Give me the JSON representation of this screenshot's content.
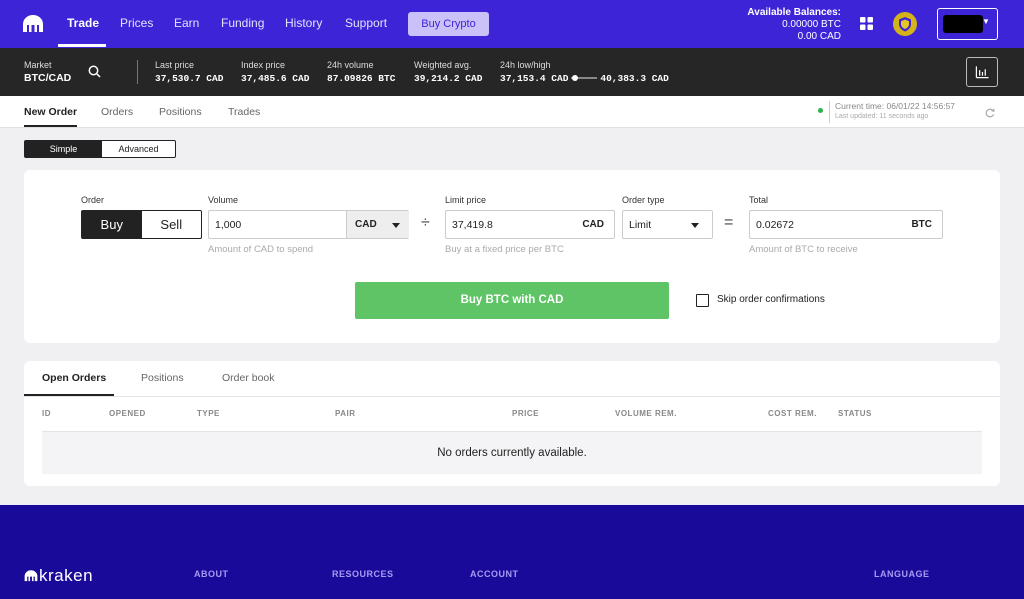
{
  "nav": {
    "links": [
      "Trade",
      "Prices",
      "Earn",
      "Funding",
      "History",
      "Support"
    ],
    "buy_crypto": "Buy Crypto",
    "balances": {
      "title": "Available Balances:",
      "btc": "0.00000 BTC",
      "cad": "0.00 CAD"
    }
  },
  "ticker": {
    "market_label": "Market",
    "market_value": "BTC/CAD",
    "last_label": "Last price",
    "last_value": "37,530.7 CAD",
    "index_label": "Index price",
    "index_value": "37,485.6 CAD",
    "vol_label": "24h volume",
    "vol_value": "87.09826 BTC",
    "wavg_label": "Weighted avg.",
    "wavg_value": "39,214.2 CAD",
    "lh_label": "24h low/high",
    "low_value": "37,153.4 CAD",
    "high_value": "40,383.3 CAD",
    "range_position": 0.05
  },
  "tabs": [
    "New Order",
    "Orders",
    "Positions",
    "Trades"
  ],
  "status": {
    "current_time": "Current time: 06/01/22 14:56:57",
    "last_updated": "Last updated: 11 seconds ago",
    "color": "#2db34a"
  },
  "mode": {
    "simple": "Simple",
    "advanced": "Advanced"
  },
  "order": {
    "order_label": "Order",
    "buy": "Buy",
    "sell": "Sell",
    "volume_label": "Volume",
    "volume_value": "1,000",
    "volume_unit": "CAD",
    "volume_hint": "Amount of CAD to spend",
    "divide": "÷",
    "limit_label": "Limit price",
    "limit_value": "37,419.8",
    "limit_unit": "CAD",
    "limit_hint": "Buy at a fixed price per BTC",
    "type_label": "Order type",
    "type_value": "Limit",
    "equals": "=",
    "total_label": "Total",
    "total_value": "0.02672",
    "total_unit": "BTC",
    "total_hint": "Amount of BTC to receive",
    "submit": "Buy BTC with CAD",
    "skip_confirm": "Skip order confirmations"
  },
  "orders_panel": {
    "tabs": [
      "Open Orders",
      "Positions",
      "Order book"
    ],
    "columns": [
      "ID",
      "OPENED",
      "TYPE",
      "PAIR",
      "PRICE",
      "VOLUME REM.",
      "COST REM.",
      "STATUS"
    ],
    "empty": "No orders currently available."
  },
  "footer": {
    "logo": "kraken",
    "headings": [
      "ABOUT",
      "RESOURCES",
      "ACCOUNT",
      "LANGUAGE"
    ]
  },
  "colors": {
    "brand": "#3d24d6",
    "buy_green": "#5ec466",
    "footer": "#1a0a9a"
  }
}
